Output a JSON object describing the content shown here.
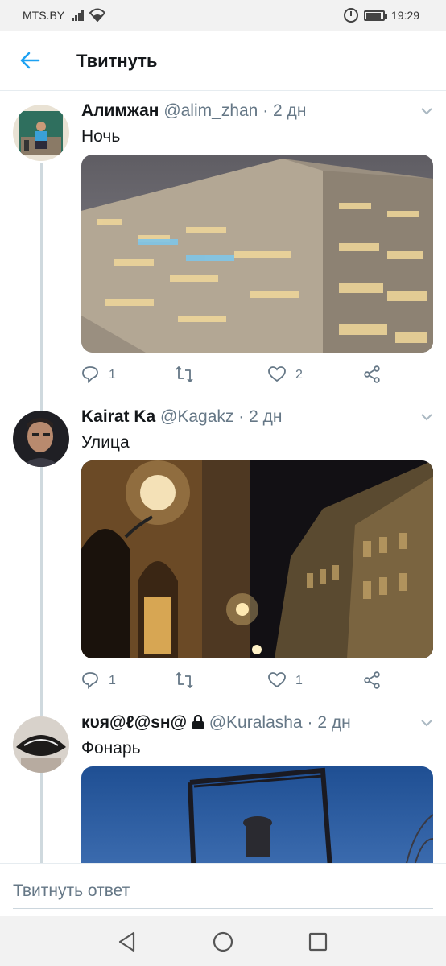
{
  "status_bar": {
    "carrier": "MTS.BY",
    "time": "19:29",
    "icons": [
      "signal-icon",
      "wifi-icon",
      "alarm-icon",
      "battery-icon"
    ]
  },
  "app_bar": {
    "title": "Твитнуть",
    "back_icon": "arrow-left-icon"
  },
  "tweets": [
    {
      "name": "Алимжан",
      "handle": "@alim_zhan",
      "separator": "·",
      "ago": "2 дн",
      "text": "Ночь",
      "replies": "1",
      "retweets": "",
      "likes": "2",
      "image": "night-apartment-building"
    },
    {
      "name": "Kairat Ka",
      "handle": "@Kagakz",
      "separator": "·",
      "ago": "2 дн",
      "text": "Улица",
      "replies": "1",
      "retweets": "",
      "likes": "1",
      "image": "night-street-lanterns"
    },
    {
      "name": "кυя@ℓ@ѕн@",
      "handle": "@Kuralasha",
      "separator": "·",
      "ago": "2 дн",
      "text": "Фонарь",
      "locked": true,
      "image": "street-lamp-blue-sky"
    }
  ],
  "reply": {
    "placeholder": "Твитнуть ответ"
  },
  "nav_bar": {
    "icons": [
      "back-triangle-icon",
      "home-circle-icon",
      "recents-square-icon"
    ]
  },
  "colors": {
    "accent": "#1da1f2",
    "text": "#14171a",
    "secondary": "#657786",
    "thread_line": "#cfd9de"
  }
}
